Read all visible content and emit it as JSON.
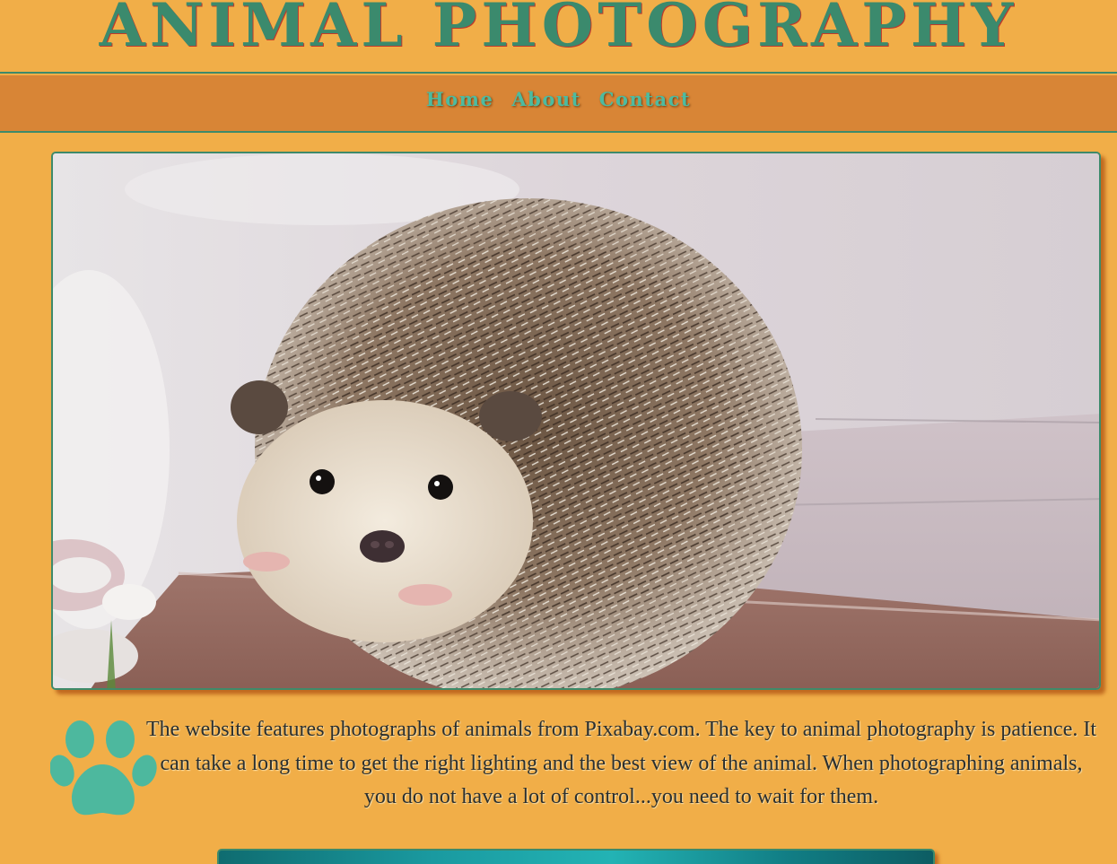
{
  "header": {
    "site_title": "ANIMAL PHOTOGRAPHY"
  },
  "nav": {
    "items": [
      {
        "label": "Home"
      },
      {
        "label": "About"
      },
      {
        "label": "Contact"
      }
    ]
  },
  "main": {
    "intro": "The website features photographs of animals from Pixabay.com. The key to animal photography is patience. It can take a long time to get the right lighting and the best view of the animal. When photographing animals, you do not have a lot of control...you need to wait for them."
  },
  "icons": {
    "intro_icon": "paw-icon"
  },
  "colors": {
    "page_background": "#f1ae48",
    "nav_background": "#d88536",
    "accent_green": "#3b8a6d",
    "nav_link": "#4dbba0",
    "paw": "#4db89e"
  }
}
